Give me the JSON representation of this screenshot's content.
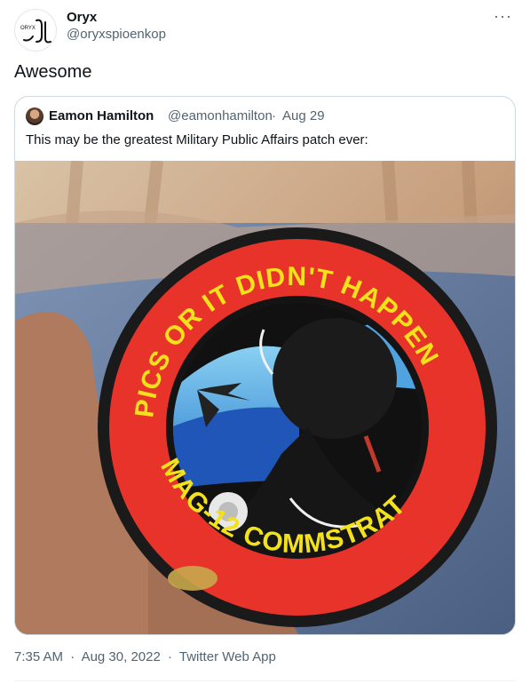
{
  "author": {
    "name": "Oryx",
    "handle": "@oryxspioenkop",
    "avatar_logo_text": "ORYX",
    "avatar_icon": "oryx-logo-icon"
  },
  "more_icon": "more-horizontal-icon",
  "tweet": {
    "text": "Awesome"
  },
  "quoted": {
    "author_name": "Eamon Hamilton",
    "author_handle": "@eamonhamilton",
    "separator": "·",
    "date": "Aug 29",
    "text": "This may be the greatest Military Public Affairs patch ever:",
    "media": {
      "patch_top_text": "PICS OR IT DIDN'T HAPPEN",
      "patch_bottom_text": "MAG-12 COMMSTRAT",
      "colors": {
        "ring_red": "#e8332b",
        "border_black": "#141414",
        "sky_blue": "#4fa3e0",
        "deep_blue": "#1f56b8",
        "text_yellow": "#f3e21b"
      }
    }
  },
  "meta": {
    "time": "7:35 AM",
    "sep1": "·",
    "date": "Aug 30, 2022",
    "sep2": "·",
    "app": "Twitter Web App"
  }
}
